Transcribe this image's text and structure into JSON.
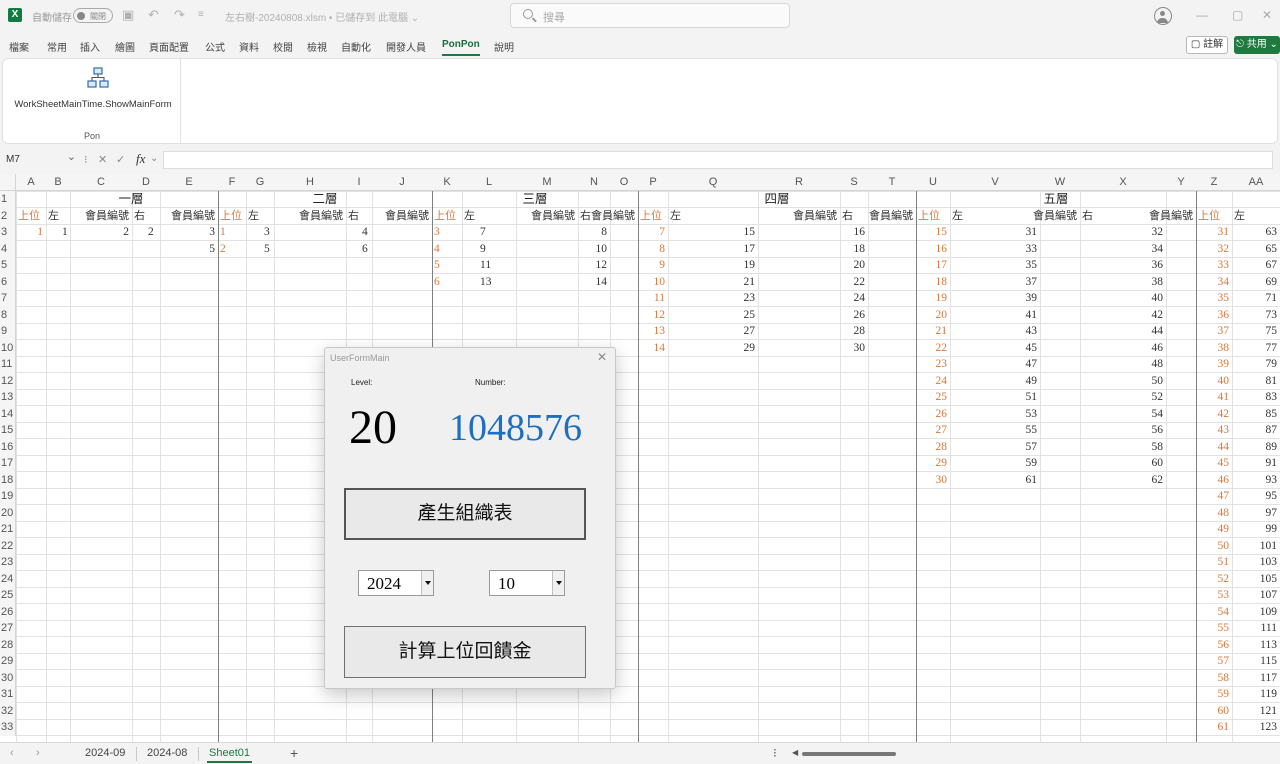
{
  "titlebar": {
    "app_icon": "excel-icon",
    "autosave_label": "自動儲存",
    "autosave_state": "關閉",
    "doc_title": "左右樹-20240808.xlsm • 已儲存到 此電腦 ⌄",
    "search_placeholder": "搜尋"
  },
  "menu": {
    "tabs": [
      "檔案",
      "常用",
      "插入",
      "繪圖",
      "頁面配置",
      "公式",
      "資料",
      "校閱",
      "檢視",
      "自動化",
      "開發人員",
      "PonPon",
      "說明"
    ],
    "active_tab": "PonPon",
    "comment_label": "▢ 註解",
    "share_label": "⎋ 共用 ⌄"
  },
  "ribbon": {
    "button_label": "WorkSheetMainTime.ShowMainForm",
    "button_icon": "org-chart-icon",
    "group_label": "Pon"
  },
  "formula_bar": {
    "name_box": "M7",
    "fx_label": "fx",
    "content": ""
  },
  "sheet": {
    "columns": [
      "A",
      "B",
      "C",
      "D",
      "E",
      "F",
      "G",
      "H",
      "I",
      "J",
      "K",
      "L",
      "M",
      "N",
      "O",
      "P",
      "Q",
      "R",
      "S",
      "T",
      "U",
      "V",
      "W",
      "X",
      "Y",
      "Z",
      "AA"
    ],
    "rows": [
      "1",
      "2",
      "3",
      "4",
      "5",
      "6",
      "7",
      "8",
      "9",
      "10",
      "11",
      "12",
      "13",
      "14",
      "15",
      "16",
      "17",
      "18",
      "19",
      "20",
      "21",
      "22",
      "23",
      "24",
      "25",
      "26",
      "27",
      "28",
      "29",
      "30",
      "31",
      "32",
      "33"
    ],
    "section_titles": [
      "一層",
      "二層",
      "三層",
      "四層",
      "五層"
    ],
    "labels": {
      "upper": "上位",
      "left": "左",
      "right": "右",
      "member_a": "會員編號",
      "member_b": "會員編號"
    },
    "level1": {
      "upper": [
        1
      ],
      "left": [
        1
      ],
      "right": [
        2
      ],
      "member_a": [
        2
      ],
      "member_b": [
        3,
        5
      ]
    },
    "level2": {
      "upper": [
        1,
        2
      ],
      "left": [
        3,
        5
      ],
      "right": [
        4,
        6
      ]
    },
    "level3": {
      "upper": [
        3,
        4,
        5,
        6
      ],
      "left": [
        7,
        9,
        11,
        13
      ],
      "right": [
        8,
        10,
        12,
        14
      ]
    },
    "level4": {
      "upper": [
        7,
        8,
        9,
        10,
        11,
        12,
        13,
        14
      ],
      "left": [
        15,
        17,
        19,
        21,
        23,
        25,
        27,
        29
      ],
      "right": [
        16,
        18,
        20,
        22,
        24,
        26,
        28,
        30
      ]
    },
    "level5": {
      "upper": [
        15,
        16,
        17,
        18,
        19,
        20,
        21,
        22,
        23,
        24,
        25,
        26,
        27,
        28,
        29,
        30
      ],
      "left": [
        31,
        33,
        35,
        37,
        39,
        41,
        43,
        45,
        47,
        49,
        51,
        53,
        55,
        57,
        59,
        61
      ],
      "right": [
        32,
        34,
        36,
        38,
        40,
        42,
        44,
        46,
        48,
        50,
        52,
        54,
        56,
        58,
        60,
        62
      ]
    },
    "level6": {
      "upper": [
        31,
        32,
        33,
        34,
        35,
        36,
        37,
        38,
        39,
        40,
        41,
        42,
        43,
        44,
        45,
        46,
        47,
        48,
        49,
        50,
        51,
        52,
        53,
        54,
        55,
        56,
        57,
        58,
        59,
        60,
        61
      ],
      "left": [
        63,
        65,
        67,
        69,
        71,
        73,
        75,
        77,
        79,
        81,
        83,
        85,
        87,
        89,
        91,
        93,
        95,
        97,
        99,
        101,
        103,
        105,
        107,
        109,
        111,
        113,
        115,
        117,
        119,
        121,
        123
      ]
    }
  },
  "userform": {
    "title": "UserFormMain",
    "level_label": "Level:",
    "level_value": "20",
    "number_label": "Number:",
    "number_value": "1048576",
    "generate_button": "產生組織表",
    "year_value": "2024",
    "month_value": "10",
    "calc_button": "計算上位回饋金"
  },
  "sheet_tabs": {
    "tabs": [
      "2024-09",
      "2024-08",
      "Sheet01"
    ],
    "active": "Sheet01"
  },
  "colors": {
    "accent": "#1a7a43",
    "orange_text": "#d8783c",
    "number_blue": "#1d6fc0"
  }
}
